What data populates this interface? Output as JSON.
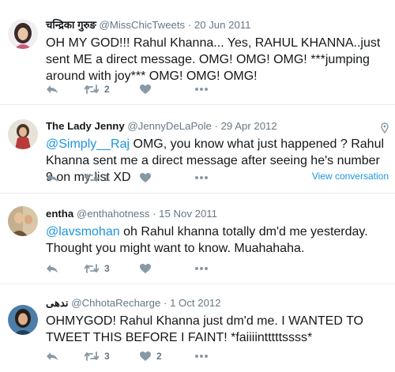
{
  "tweets": [
    {
      "name": "चन्द्रिका गुरुङ",
      "handle": "@MissChicTweets",
      "date": "20 Jun 2011",
      "text": "OH MY GOD!!! Rahul Khanna... Yes, RAHUL KHANNA..just sent ME a direct message. OMG! OMG! OMG! ***jumping around with joy*** OMG! OMG! OMG!",
      "retweets": "2",
      "likes": ""
    },
    {
      "name": "The Lady Jenny",
      "handle": "@JennyDeLaPole",
      "date": "29 Apr 2012",
      "mention": "@Simply__Raj",
      "text": " OMG, you know what just happened ? Rahul Khanna sent me a direct message after seeing he's number 9 on my list XD",
      "retweets": "1",
      "likes": "",
      "view_conversation": "View conversation"
    },
    {
      "name": "entha",
      "handle": "@enthahotness",
      "date": "15 Nov 2011",
      "mention": "@lavsmohan",
      "text": " oh Rahul khanna totally dm'd me yesterday. Thought you might want to know. Muahahaha.",
      "retweets": "3",
      "likes": ""
    },
    {
      "name": "ندهی",
      "handle": "@ChhotaRecharge",
      "date": "1 Oct 2012",
      "text": "OHMYGOD! Rahul Khanna just dm'd me. I WANTED TO TWEET THIS BEFORE I FAINT! *faiiiintttttssss*",
      "retweets": "3",
      "likes": "2"
    }
  ],
  "separator": "·",
  "icons": {
    "reply": "reply-icon",
    "retweet": "retweet-icon",
    "like": "heart-icon",
    "more": "more-icon",
    "geo": "location-pin-icon"
  },
  "colors": {
    "link": "#1b95e0",
    "muted": "#657786",
    "action": "#8899a6",
    "border": "#e6ecf0"
  }
}
